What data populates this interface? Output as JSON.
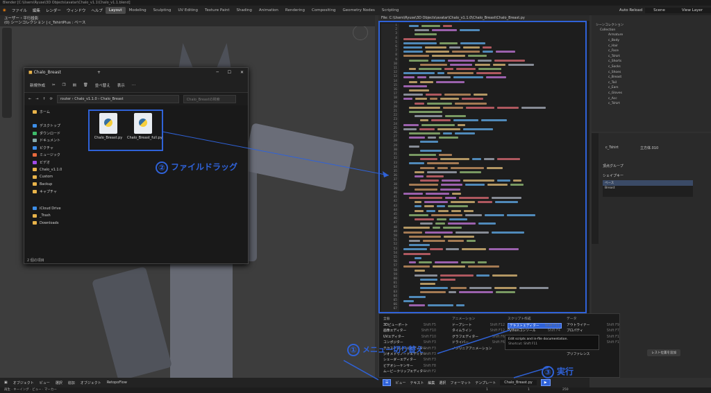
{
  "window": {
    "title": "Blender [C:\\Users\\Ryuse\\3D Objects\\avatar\\Chalo_v1.1\\Chalo_v1.1.blend]"
  },
  "menubar": {
    "items": [
      "ファイル",
      "編集",
      "レンダー",
      "ウィンドウ",
      "ヘルプ"
    ],
    "workspaces": [
      "Layout",
      "Modeling",
      "Sculpting",
      "UV Editing",
      "Texture Paint",
      "Shading",
      "Animation",
      "Rendering",
      "Compositing",
      "Geometry Nodes",
      "Scripting"
    ],
    "active_workspace": "Layout",
    "auto_reload": "Auto Reload",
    "scene": "Scene",
    "view_layer": "View Layer"
  },
  "viewport": {
    "mode_line1": "ユーザー・平行投影",
    "mode_line2": "(0) シーンコレクション | c_TshirtPlus : ベース",
    "footer": [
      "オブジェクト",
      "ビュー",
      "選択",
      "追加",
      "オブジェクト",
      "RetopoFlow"
    ]
  },
  "explorer": {
    "title": "Chalo_Breast",
    "toolbar": [
      "新規作成",
      "並べ替え",
      "表示"
    ],
    "path": [
      "router",
      "Chalo_v1.1.0",
      "Chalo_Breast"
    ],
    "search_placeholder": "Chalo_Breastの検索",
    "nav": [
      "ホーム",
      "デスクトップ",
      "ダウンロード",
      "ドキュメント",
      "ピクチャ",
      "ミュージック",
      "ビデオ",
      "Chalo_v1.1.0",
      "Custom",
      "Backup",
      "キャプチャ",
      "iCloud Drive",
      "_Trash",
      "Downloads"
    ],
    "files": [
      "Chalo_Breast.py",
      "Chalo_Breast_full.py"
    ],
    "status": "2 個の項目"
  },
  "texteditor": {
    "filepath": "File: C:\\Users\\Ryuse\\3D Objects\\avatar\\Chalo_v1.1.0\\Chalo_Breast\\Chalo_Breast.py",
    "filename": "Chalo_Breast.py",
    "footer": [
      "ビュー",
      "テキスト",
      "編集",
      "選択",
      "フォーマット",
      "テンプレート"
    ]
  },
  "menu": {
    "headers": [
      "全般",
      "アニメーション",
      "スクリプト作成",
      "データ"
    ],
    "general": [
      [
        "3Dビューポート",
        "Shift F5"
      ],
      [
        "画像エディター",
        "Shift F10"
      ],
      [
        "UVエディター",
        "Shift F10"
      ],
      [
        "コンポジター",
        "Shift F3"
      ],
      [
        "テクスチャノードエディター",
        "Shift F3"
      ],
      [
        "ジオメトリノードエディター",
        "Shift F3"
      ],
      [
        "シェーダーエディター",
        "Shift F3"
      ],
      [
        "ビデオシーケンサー",
        "Shift F8"
      ],
      [
        "ムービークリップエディター",
        "Shift F2"
      ]
    ],
    "animation": [
      [
        "ドープシート",
        "Shift F12"
      ],
      [
        "タイムライン",
        "Shift F12"
      ],
      [
        "グラフエディター",
        "Shift F6"
      ],
      [
        "ドライバー",
        "Shift F6"
      ],
      [
        "ノンリニアアニメーション",
        ""
      ]
    ],
    "scripting": [
      [
        "テキストエディター",
        "Shift F11"
      ],
      [
        "Pythonコンソール",
        "Shift F4"
      ],
      [
        "情報",
        ""
      ]
    ],
    "data": [
      [
        "アウトライナー",
        "Shift F9"
      ],
      [
        "プロパティ",
        "Shift F7"
      ],
      [
        "ファイルブラウザー",
        "Shift F1"
      ],
      [
        "アセットブラウザー",
        "Shift F1"
      ],
      [
        "スプレッドシート",
        ""
      ],
      [
        "プリファレンス",
        ""
      ]
    ],
    "tooltip_title": "Edit scripts and in-file documentation.",
    "tooltip_shortcut": "Shortcut: Shift F11"
  },
  "annotations": {
    "step1": "メニュー切り替え",
    "step2": "ファイルドラッグ",
    "step3": "実行",
    "n1": "①",
    "n2": "②",
    "n3": "③"
  },
  "outliner": {
    "rows": [
      "シーンコレクション",
      "Collection",
      "Armature",
      "c_Body",
      "c_Hair",
      "c_Face",
      "c_Tshirt",
      "c_Shorts",
      "c_Socks",
      "c_Shoes",
      "c_Breast",
      "c_Tail",
      "c_Ears",
      "c_Gloves",
      "c_Acc",
      "c_Tshirt"
    ]
  },
  "properties": {
    "object": "c_Tshirt",
    "mesh": "立方体.010",
    "section1": "頂点グループ",
    "section2": "シェイプキー",
    "key1": "ベース",
    "key2": "Breast",
    "add_label": "レスト位置を追加"
  },
  "timeline": {
    "items": [
      "再生",
      "キーイング",
      "ビュー",
      "マーカー"
    ],
    "frame": "1",
    "start": "1",
    "end": "250"
  }
}
